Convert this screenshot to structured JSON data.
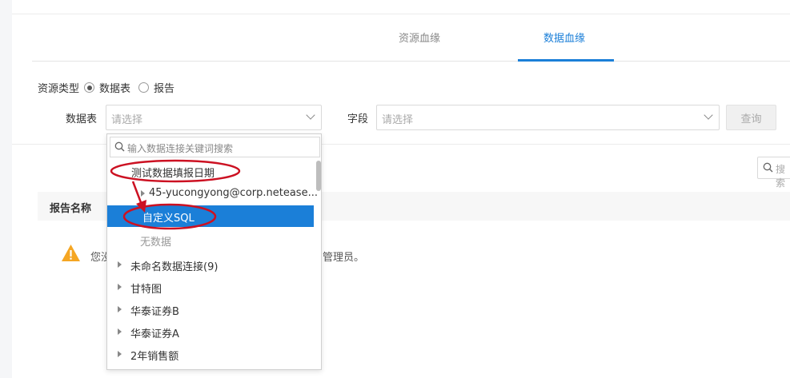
{
  "tabs": {
    "resource_lineage": "资源血缘",
    "data_lineage": "数据血缘"
  },
  "filters": {
    "resource_type_label": "资源类型",
    "options": [
      "数据表",
      "报告"
    ],
    "selected": "数据表",
    "table_label": "数据表",
    "table_placeholder": "请选择",
    "field_label": "字段",
    "field_placeholder": "请选择",
    "query_button": "查询"
  },
  "search": {
    "placeholder": "搜索"
  },
  "table": {
    "header_report_name": "报告名称"
  },
  "notice": {
    "text_start": "您没",
    "text_end": "管理员。"
  },
  "dropdown": {
    "search_placeholder": "输入数据连接关键词搜索",
    "items": [
      {
        "label": "测试数据填报日期",
        "level": 0,
        "expandable": false
      },
      {
        "label": "45-yucongyong@corp.netease...",
        "level": 1,
        "expandable": true
      },
      {
        "label": "自定义SQL",
        "level": 1,
        "expandable": false,
        "selected": true
      },
      {
        "label": "无数据",
        "level": 2,
        "expandable": false,
        "empty": true
      },
      {
        "label": "未命名数据连接(9)",
        "level": 0,
        "expandable": true
      },
      {
        "label": "甘特图",
        "level": 0,
        "expandable": true
      },
      {
        "label": "华泰证券B",
        "level": 0,
        "expandable": true
      },
      {
        "label": "华泰证券A",
        "level": 0,
        "expandable": true
      },
      {
        "label": "2年销售额",
        "level": 0,
        "expandable": true
      }
    ]
  },
  "colors": {
    "accent": "#1b7fd8",
    "annotation": "#cc1122",
    "warning": "#f5a623"
  }
}
